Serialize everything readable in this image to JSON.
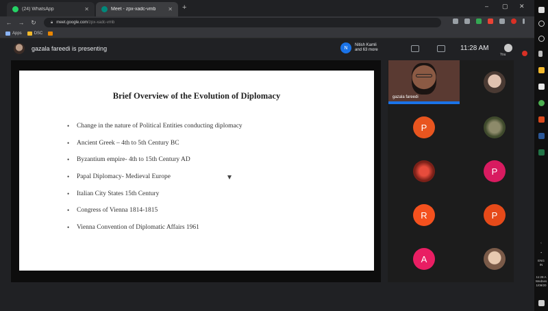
{
  "browser": {
    "tabs": [
      {
        "label": "(24) WhatsApp",
        "favicon_color": "#25d366"
      },
      {
        "label": "Meet - zpx-xadc-vmb",
        "favicon_color": "#00897b"
      }
    ],
    "new_tab": "+",
    "url_host": "meet.google.com",
    "url_path": "/zpx-xadc-vmb",
    "bookmarks": [
      "Apps",
      "DSC"
    ],
    "window_controls": [
      "–",
      "▢",
      "✕"
    ]
  },
  "meet": {
    "presenter_text": "gazala fareedi is presenting",
    "others_badge": "N",
    "others_line1": "Nitish Kamli",
    "others_line2": "and 63 more",
    "time": "11:28 AM",
    "you_label": "You"
  },
  "slide": {
    "title": "Brief Overview of the Evolution of Diplomacy",
    "bullets": [
      "Change in the nature of Political Entities conducting diplomacy",
      "Ancient Greek – 4th to 5th Century BC",
      "Byzantium empire- 4th to 15th Century AD",
      "Papal Diplomacy- Medieval Europe",
      "Italian City States 15th Century",
      "Congress of Vienna 1814-1815",
      "Vienna Convention of Diplomatic Affairs 1961"
    ]
  },
  "participants": {
    "featured_name": "gazala fareedi",
    "tiles": [
      {
        "type": "photo",
        "color": "#c8a99a"
      },
      {
        "type": "letter",
        "letter": "P",
        "color": "#e8551f"
      },
      {
        "type": "photo",
        "color": "#6b6f4f"
      },
      {
        "type": "photo",
        "color": "#c0392b"
      },
      {
        "type": "letter",
        "letter": "P",
        "color": "#d81b60"
      },
      {
        "type": "letter",
        "letter": "R",
        "color": "#f4511e"
      },
      {
        "type": "letter",
        "letter": "P",
        "color": "#e64a19"
      },
      {
        "type": "letter",
        "letter": "A",
        "color": "#e91e63"
      },
      {
        "type": "photo",
        "color": "#d9b39a"
      }
    ]
  },
  "taskbar": {
    "lang": "ENG",
    "region": "IN",
    "clock": "11:28 A",
    "day": "Wednes",
    "date": "1/09/20"
  }
}
